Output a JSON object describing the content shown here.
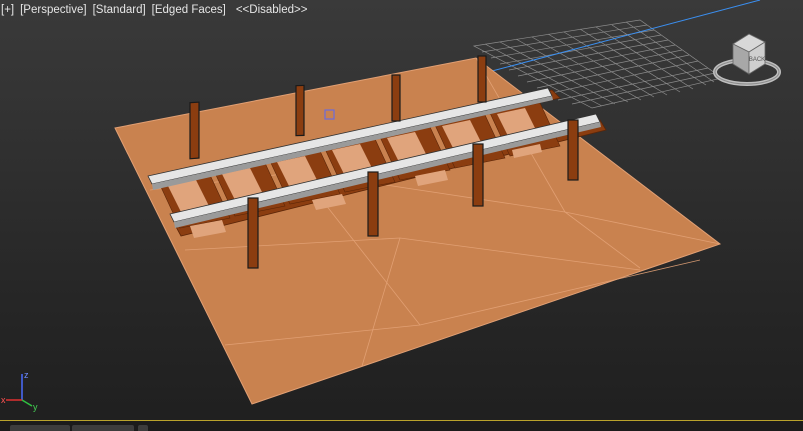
{
  "viewport": {
    "label_plus": "[+]",
    "label_view": "[Perspective]",
    "label_shading": "[Standard]",
    "label_edges": "[Edged Faces]",
    "label_disabled": "<<Disabled>>"
  },
  "navcube": {
    "face_label": "BACK"
  },
  "axis_gizmo": {
    "x": "x",
    "y": "y",
    "z": "z"
  },
  "colors": {
    "ground": "#c9824f",
    "wood_dark": "#8b3d10",
    "rail_light": "#e6e6e6",
    "plank_light": "#e0a47c",
    "accent_line": "#3b8ff0",
    "grid": "#8a8a8a"
  }
}
